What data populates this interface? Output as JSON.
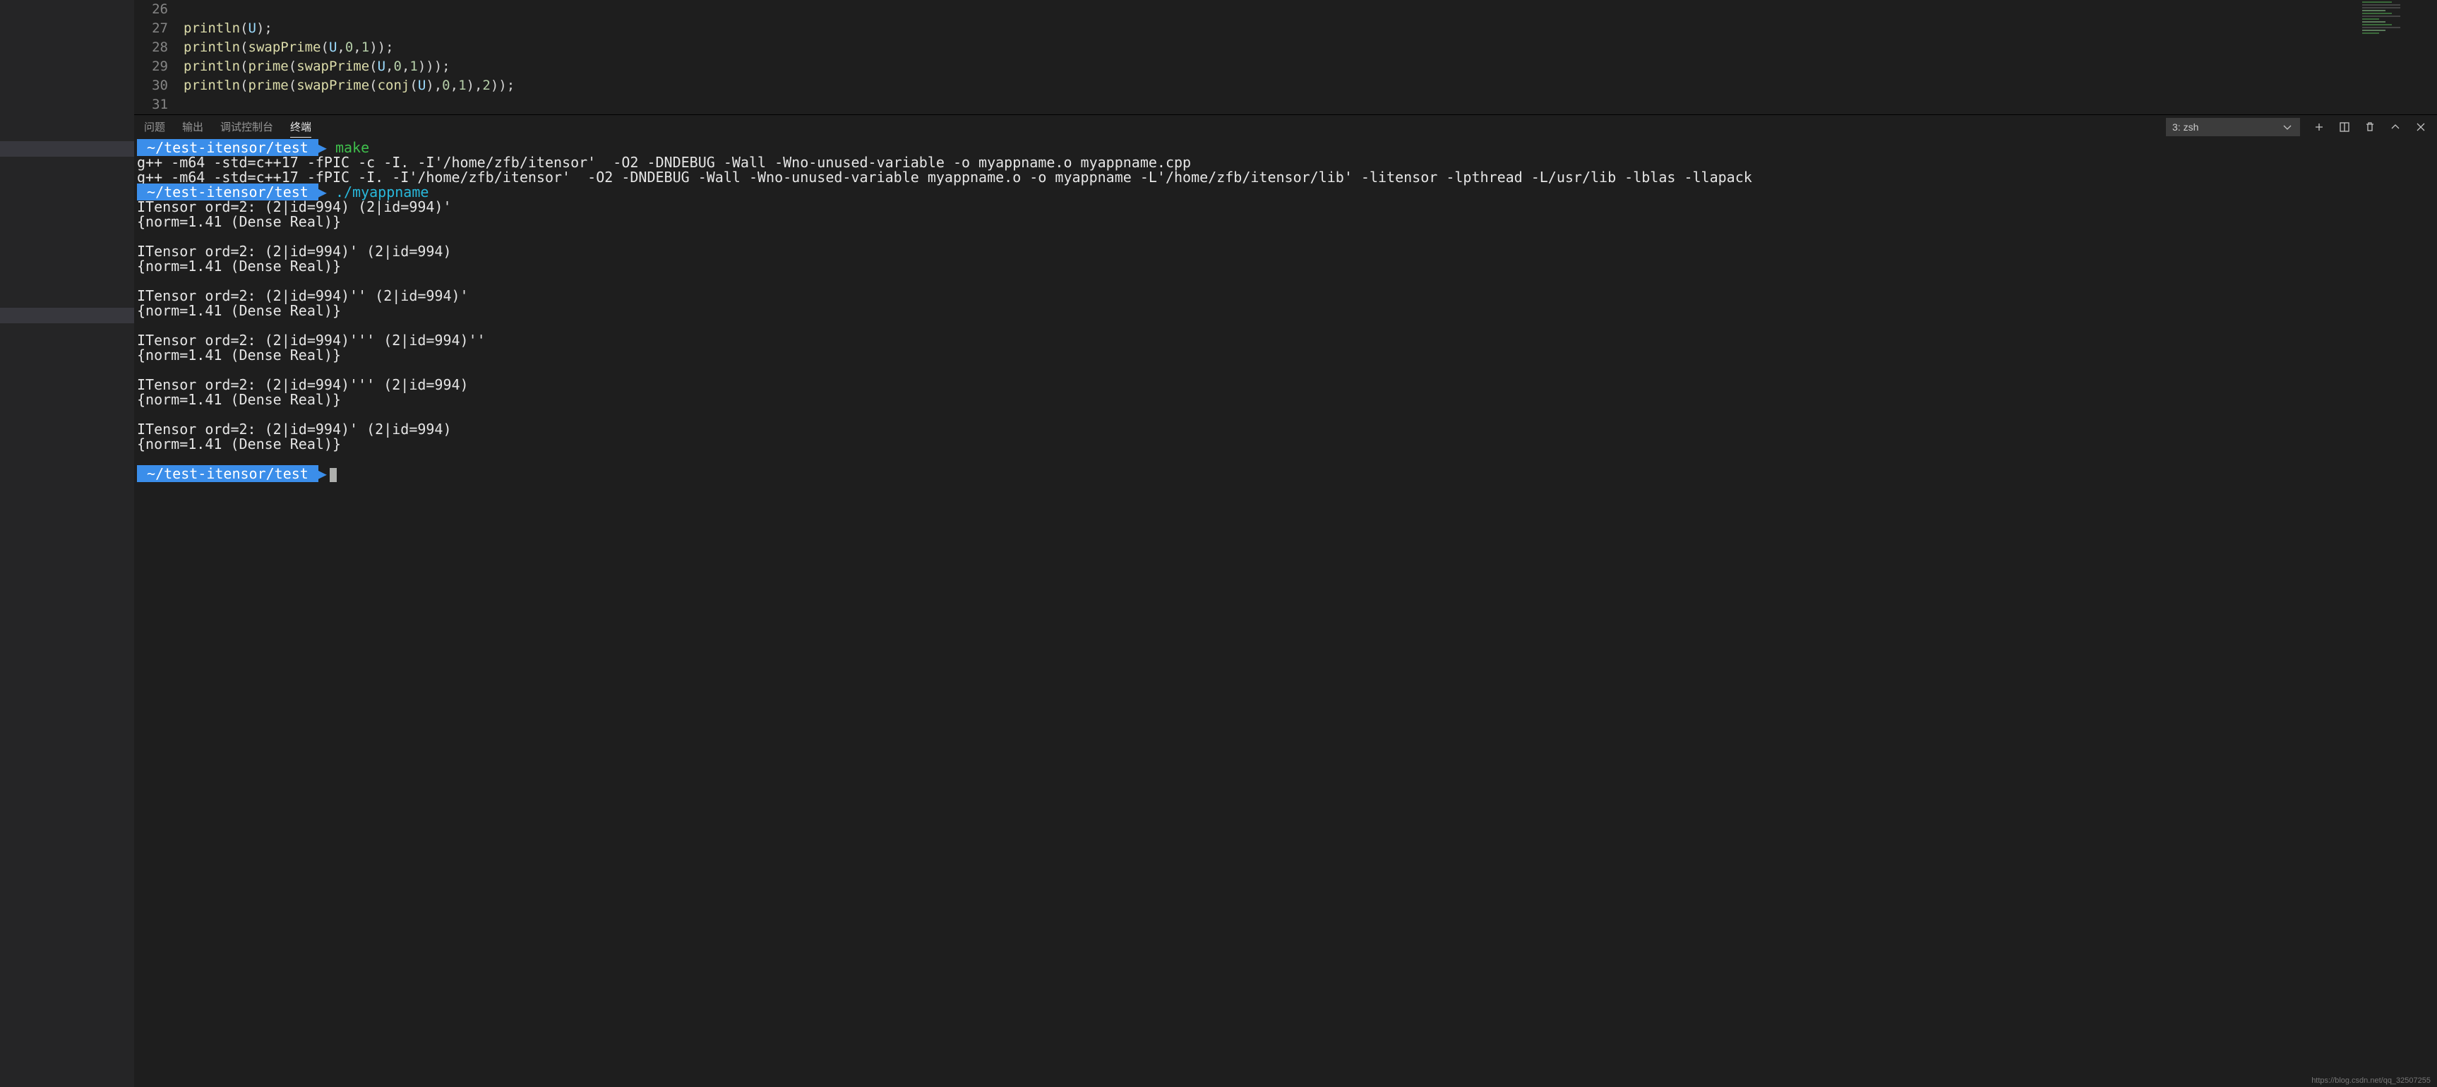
{
  "editor": {
    "lines": [
      {
        "num": "26",
        "tokens": []
      },
      {
        "num": "27",
        "tokens": [
          {
            "t": "fn",
            "v": "println"
          },
          {
            "t": "pn",
            "v": "("
          },
          {
            "t": "id",
            "v": "U"
          },
          {
            "t": "pn",
            "v": ");"
          }
        ]
      },
      {
        "num": "28",
        "tokens": [
          {
            "t": "fn",
            "v": "println"
          },
          {
            "t": "pn",
            "v": "("
          },
          {
            "t": "fn",
            "v": "swapPrime"
          },
          {
            "t": "pn",
            "v": "("
          },
          {
            "t": "id",
            "v": "U"
          },
          {
            "t": "pn",
            "v": ","
          },
          {
            "t": "num",
            "v": "0"
          },
          {
            "t": "pn",
            "v": ","
          },
          {
            "t": "num",
            "v": "1"
          },
          {
            "t": "pn",
            "v": "));"
          }
        ]
      },
      {
        "num": "29",
        "tokens": [
          {
            "t": "fn",
            "v": "println"
          },
          {
            "t": "pn",
            "v": "("
          },
          {
            "t": "fn",
            "v": "prime"
          },
          {
            "t": "pn",
            "v": "("
          },
          {
            "t": "fn",
            "v": "swapPrime"
          },
          {
            "t": "pn",
            "v": "("
          },
          {
            "t": "id",
            "v": "U"
          },
          {
            "t": "pn",
            "v": ","
          },
          {
            "t": "num",
            "v": "0"
          },
          {
            "t": "pn",
            "v": ","
          },
          {
            "t": "num",
            "v": "1"
          },
          {
            "t": "pn",
            "v": ")));"
          }
        ]
      },
      {
        "num": "30",
        "tokens": [
          {
            "t": "fn",
            "v": "println"
          },
          {
            "t": "pn",
            "v": "("
          },
          {
            "t": "fn",
            "v": "prime"
          },
          {
            "t": "pn",
            "v": "("
          },
          {
            "t": "fn",
            "v": "swapPrime"
          },
          {
            "t": "pn",
            "v": "("
          },
          {
            "t": "fn",
            "v": "conj"
          },
          {
            "t": "pn",
            "v": "("
          },
          {
            "t": "id",
            "v": "U"
          },
          {
            "t": "pn",
            "v": "),"
          },
          {
            "t": "num",
            "v": "0"
          },
          {
            "t": "pn",
            "v": ","
          },
          {
            "t": "num",
            "v": "1"
          },
          {
            "t": "pn",
            "v": "),"
          },
          {
            "t": "num",
            "v": "2"
          },
          {
            "t": "pn",
            "v": "));"
          }
        ]
      },
      {
        "num": "31",
        "tokens": []
      }
    ]
  },
  "panel": {
    "tabs": [
      "问题",
      "输出",
      "调试控制台",
      "终端"
    ],
    "active_tab_index": 3,
    "selector_label": "3: zsh"
  },
  "terminal": {
    "prompt_path": " ~/test-itensor/test ",
    "arrow": "▶",
    "cmd1": "make",
    "compile_lines": [
      "g++ -m64 -std=c++17 -fPIC -c -I. -I'/home/zfb/itensor'  -O2 -DNDEBUG -Wall -Wno-unused-variable -o myappname.o myappname.cpp",
      "g++ -m64 -std=c++17 -fPIC -I. -I'/home/zfb/itensor'  -O2 -DNDEBUG -Wall -Wno-unused-variable myappname.o -o myappname -L'/home/zfb/itensor/lib' -litensor -lpthread -L/usr/lib -lblas -llapack"
    ],
    "cmd2": "./myappname",
    "blocks": [
      [
        "ITensor ord=2: (2|id=994) (2|id=994)'",
        "{norm=1.41 (Dense Real)}"
      ],
      [
        "ITensor ord=2: (2|id=994)' (2|id=994)",
        "{norm=1.41 (Dense Real)}"
      ],
      [
        "ITensor ord=2: (2|id=994)'' (2|id=994)'",
        "{norm=1.41 (Dense Real)}"
      ],
      [
        "ITensor ord=2: (2|id=994)''' (2|id=994)''",
        "{norm=1.41 (Dense Real)}"
      ],
      [
        "ITensor ord=2: (2|id=994)''' (2|id=994)",
        "{norm=1.41 (Dense Real)}"
      ],
      [
        "ITensor ord=2: (2|id=994)' (2|id=994)",
        "{norm=1.41 (Dense Real)}"
      ]
    ]
  },
  "watermark": "https://blog.csdn.net/qq_32507255"
}
